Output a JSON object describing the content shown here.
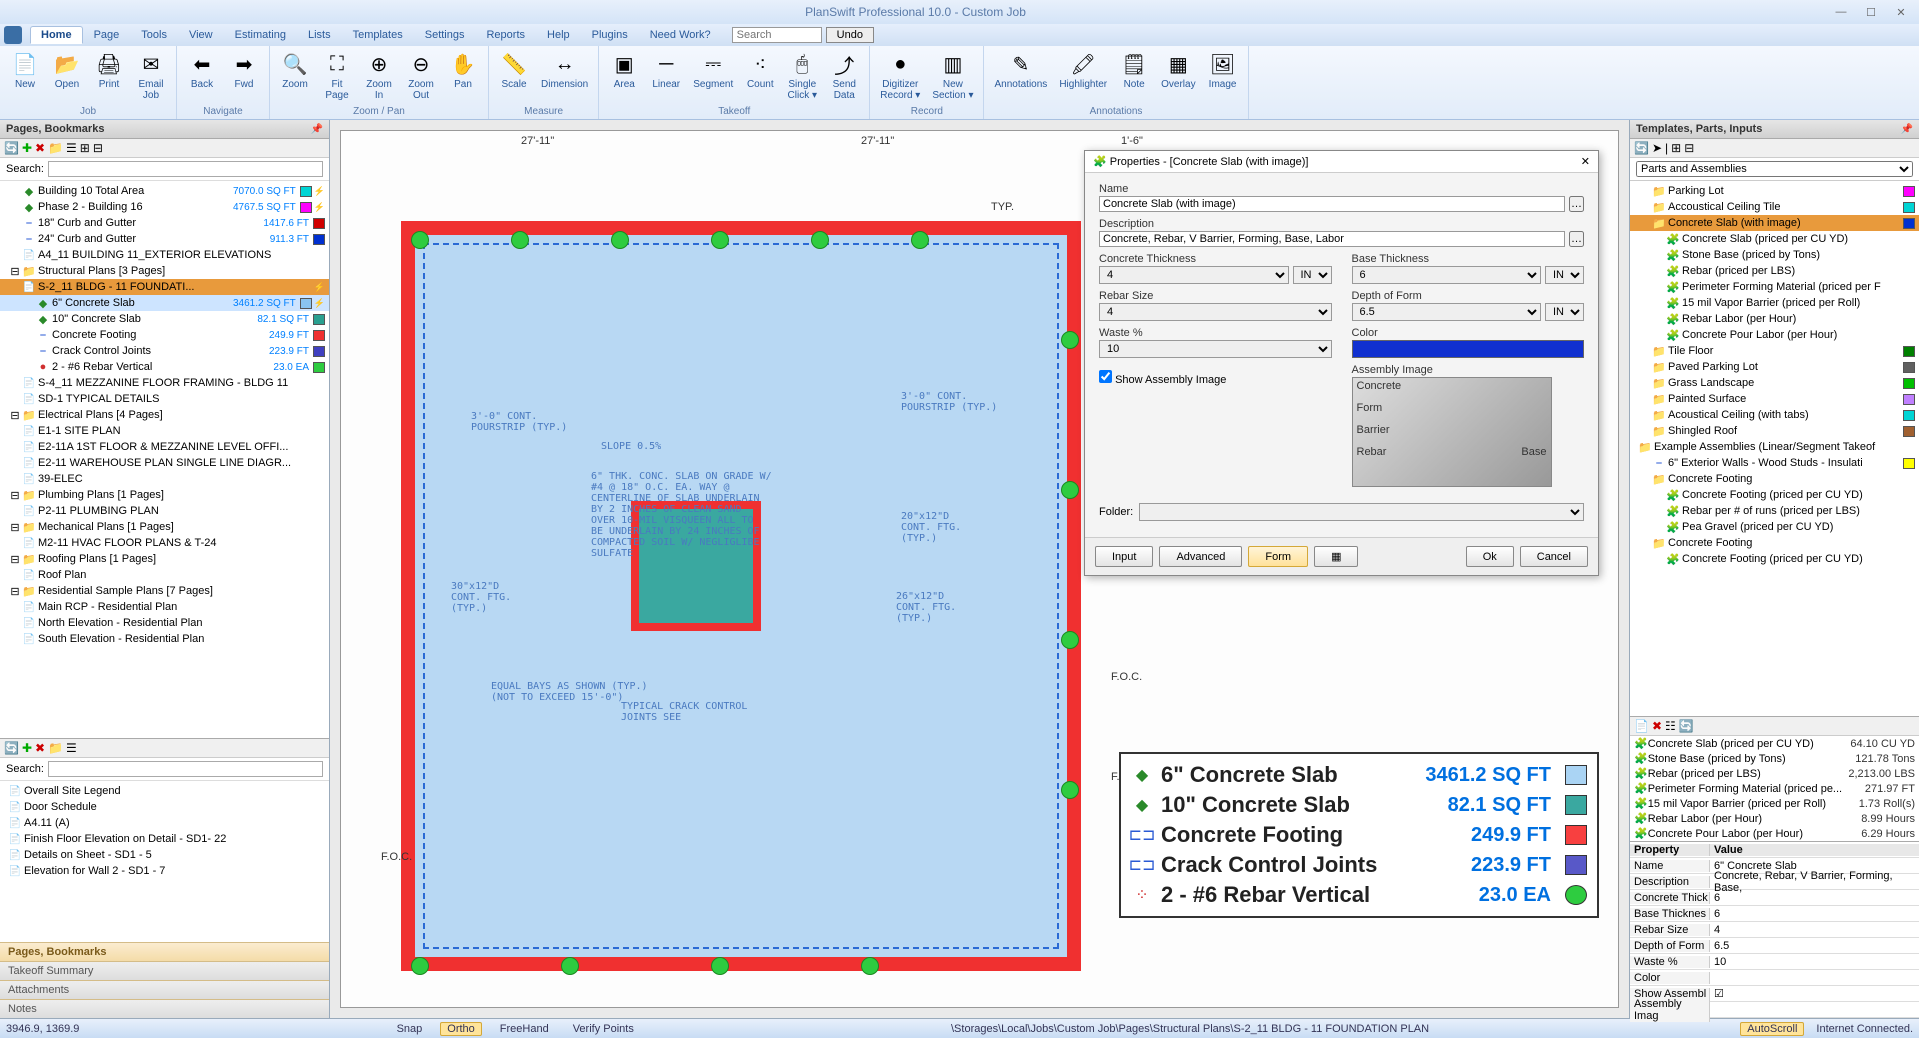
{
  "app": {
    "title": "PlanSwift Professional 10.0 - Custom Job",
    "undo_btn": "Undo",
    "search_placeholder": "Search"
  },
  "menutabs": [
    "Home",
    "Page",
    "Tools",
    "View",
    "Estimating",
    "Lists",
    "Templates",
    "Settings",
    "Reports",
    "Help",
    "Plugins",
    "Need Work?"
  ],
  "ribbon": {
    "groups": [
      {
        "label": "Job",
        "items": [
          {
            "l": "New",
            "i": "📄"
          },
          {
            "l": "Open",
            "i": "📂"
          },
          {
            "l": "Print",
            "i": "🖨"
          },
          {
            "l": "Email\nJob",
            "i": "✉"
          }
        ]
      },
      {
        "label": "Navigate",
        "items": [
          {
            "l": "Back",
            "i": "⬅"
          },
          {
            "l": "Fwd",
            "i": "➡"
          }
        ]
      },
      {
        "label": "Zoom / Pan",
        "items": [
          {
            "l": "Zoom",
            "i": "🔍"
          },
          {
            "l": "Fit\nPage",
            "i": "⛶"
          },
          {
            "l": "Zoom\nIn",
            "i": "⊕"
          },
          {
            "l": "Zoom\nOut",
            "i": "⊖"
          },
          {
            "l": "Pan",
            "i": "✋"
          }
        ]
      },
      {
        "label": "Measure",
        "items": [
          {
            "l": "Scale",
            "i": "📏"
          },
          {
            "l": "Dimension",
            "i": "↔"
          }
        ]
      },
      {
        "label": "Takeoff",
        "items": [
          {
            "l": "Area",
            "i": "▣"
          },
          {
            "l": "Linear",
            "i": "─"
          },
          {
            "l": "Segment",
            "i": "⎓"
          },
          {
            "l": "Count",
            "i": "⁖"
          },
          {
            "l": "Single\nClick ▾",
            "i": "🖱"
          },
          {
            "l": "Send\nData",
            "i": "⤴"
          }
        ]
      },
      {
        "label": "Record",
        "items": [
          {
            "l": "Digitizer\nRecord ▾",
            "i": "●"
          },
          {
            "l": "New\nSection ▾",
            "i": "▥"
          }
        ]
      },
      {
        "label": "Annotations",
        "items": [
          {
            "l": "Annotations",
            "i": "✎"
          },
          {
            "l": "Highlighter",
            "i": "🖍"
          },
          {
            "l": "Note",
            "i": "🗒"
          },
          {
            "l": "Overlay",
            "i": "▦"
          },
          {
            "l": "Image",
            "i": "🖼"
          }
        ]
      }
    ]
  },
  "left_header": "Pages, Bookmarks",
  "search_label": "Search:",
  "left_tree": [
    {
      "d": 1,
      "i": "area",
      "t": "Building 10 Total Area",
      "v": "7070.0 SQ FT",
      "c": "#00d4d4",
      "flag": true
    },
    {
      "d": 1,
      "i": "area",
      "t": "Phase 2 - Building 16",
      "v": "4767.5 SQ FT",
      "c": "#ff00ff",
      "flag": true
    },
    {
      "d": 1,
      "i": "lin",
      "t": "18\" Curb and Gutter",
      "v": "1417.6 FT",
      "c": "#d00000"
    },
    {
      "d": 1,
      "i": "lin",
      "t": "24\" Curb and Gutter",
      "v": "911.3 FT",
      "c": "#0030d0"
    },
    {
      "d": 1,
      "i": "file",
      "t": "A4_11 BUILDING 11_EXTERIOR ELEVATIONS"
    },
    {
      "d": 0,
      "i": "fold",
      "t": "Structural Plans [3 Pages]",
      "exp": true
    },
    {
      "d": 1,
      "i": "file",
      "t": "S-2_11 BLDG - 11 FOUNDATI...",
      "sel": true,
      "flag": true,
      "extra": "★ ⚡"
    },
    {
      "d": 2,
      "i": "area",
      "t": "6\" Concrete Slab",
      "v": "3461.2 SQ FT",
      "c": "#8ac4f0",
      "sel2": true,
      "flag": true
    },
    {
      "d": 2,
      "i": "area",
      "t": "10\" Concrete Slab",
      "v": "82.1 SQ FT",
      "c": "#2aa090"
    },
    {
      "d": 2,
      "i": "lin",
      "t": "Concrete Footing",
      "v": "249.9 FT",
      "c": "#f03030"
    },
    {
      "d": 2,
      "i": "lin",
      "t": "Crack Control Joints",
      "v": "223.9 FT",
      "c": "#4040c0"
    },
    {
      "d": 2,
      "i": "cnt",
      "t": "2 - #6 Rebar Vertical",
      "v": "23.0 EA",
      "c": "#2ecc40"
    },
    {
      "d": 1,
      "i": "file",
      "t": "S-4_11 MEZZANINE FLOOR FRAMING - BLDG 11"
    },
    {
      "d": 1,
      "i": "file",
      "t": "SD-1 TYPICAL DETAILS"
    },
    {
      "d": 0,
      "i": "fold",
      "t": "Electrical Plans [4 Pages]",
      "exp": true
    },
    {
      "d": 1,
      "i": "file",
      "t": "E1-1 SITE PLAN"
    },
    {
      "d": 1,
      "i": "file",
      "t": "E2-11A 1ST FLOOR & MEZZANINE LEVEL OFFI..."
    },
    {
      "d": 1,
      "i": "file",
      "t": "E2-11 WAREHOUSE PLAN SINGLE LINE DIAGR..."
    },
    {
      "d": 1,
      "i": "file",
      "t": "39-ELEC"
    },
    {
      "d": 0,
      "i": "fold",
      "t": "Plumbing Plans [1 Pages]",
      "exp": true
    },
    {
      "d": 1,
      "i": "file",
      "t": "P2-11 PLUMBING PLAN"
    },
    {
      "d": 0,
      "i": "fold",
      "t": "Mechanical Plans [1 Pages]",
      "exp": true
    },
    {
      "d": 1,
      "i": "file",
      "t": "M2-11 HVAC FLOOR PLANS & T-24"
    },
    {
      "d": 0,
      "i": "fold",
      "t": "Roofing Plans [1 Pages]",
      "exp": true
    },
    {
      "d": 1,
      "i": "file",
      "t": "Roof Plan"
    },
    {
      "d": 0,
      "i": "fold",
      "t": "Residential Sample Plans [7 Pages]",
      "exp": true
    },
    {
      "d": 1,
      "i": "file",
      "t": "Main RCP - Residential Plan"
    },
    {
      "d": 1,
      "i": "file",
      "t": "North Elevation - Residential Plan"
    },
    {
      "d": 1,
      "i": "file",
      "t": "South Elevation - Residential Plan"
    }
  ],
  "lower_left": [
    {
      "t": "Overall Site Legend"
    },
    {
      "t": "Door Schedule"
    },
    {
      "t": "A4.11 (A)"
    },
    {
      "t": "Finish Floor Elevation on Detail - SD1- 22"
    },
    {
      "t": "Details on Sheet - SD1 - 5"
    },
    {
      "t": "Elevation for Wall 2 - SD1 - 7"
    }
  ],
  "accordions": [
    "Pages, Bookmarks",
    "Takeoff Summary",
    "Attachments",
    "Notes"
  ],
  "drawing": {
    "top_dim_left": "27'-11\"",
    "top_dim_right": "27'-11\"",
    "top_dim_far": "1'-6\"",
    "pourstrip": "3'-0\" CONT.\nPOURSTRIP (TYP.)",
    "slab_note": "6\" THK. CONC. SLAB ON GRADE W/\n#4 @ 18\" O.C. EA. WAY @\nCENTERLINE OF SLAB UNDERLAIN\nBY 2 INCHES OF CLEAN SAND\nOVER 10-MIL VISQUEEN ALL TO\nBE UNDERLAIN BY 24 INCHES OF\nCOMPACTED SOIL W/ NEGLIGLIBE\nSULFATE",
    "slope": "SLOPE 0.5%",
    "ftg30": "30\"x12\"D\nCONT. FTG.\n(TYP.)",
    "ftg20": "20\"x12\"D\nCONT. FTG.\n(TYP.)",
    "ftg26": "26\"x12\"D\nCONT. FTG.\n(TYP.)",
    "bays": "EQUAL BAYS AS SHOWN (TYP.)\n(NOT TO EXCEED 15'-0\")",
    "crack": "TYPICAL CRACK CONTROL\nJOINTS SEE",
    "foc": "F.O.C.",
    "typ": "TYP."
  },
  "legend": [
    {
      "i": "◆",
      "ic": "#2a8a2a",
      "n": "6\" Concrete Slab",
      "v": "3461.2 SQ FT",
      "c": "#aad4f4"
    },
    {
      "i": "◆",
      "ic": "#2a8a2a",
      "n": "10\" Concrete Slab",
      "v": "82.1 SQ FT",
      "c": "#3aa8a0"
    },
    {
      "i": "⊏⊐",
      "ic": "#2a5ad4",
      "n": "Concrete Footing",
      "v": "249.9 FT",
      "c": "#f84040"
    },
    {
      "i": "⊏⊐",
      "ic": "#2a5ad4",
      "n": "Crack Control Joints",
      "v": "223.9 FT",
      "c": "#5858c8"
    },
    {
      "i": "⁘",
      "ic": "#d03030",
      "n": "2 - #6 Rebar Vertical",
      "v": "23.0 EA",
      "c": "#2ecc40",
      "round": true
    }
  ],
  "dialog": {
    "title": "Properties - [Concrete Slab (with image)]",
    "fields": {
      "name_l": "Name",
      "name_v": "Concrete Slab (with image)",
      "desc_l": "Description",
      "desc_v": "Concrete, Rebar, V Barrier, Forming, Base, Labor",
      "ct_l": "Concrete Thickness",
      "ct_v": "4",
      "ct_u": "IN",
      "bt_l": "Base Thickness",
      "bt_v": "6",
      "bt_u": "IN",
      "rs_l": "Rebar Size",
      "rs_v": "4",
      "df_l": "Depth of Form",
      "df_v": "6.5",
      "df_u": "IN",
      "w_l": "Waste %",
      "w_v": "10",
      "col_l": "Color",
      "show_l": "Show Assembly Image",
      "asm_l": "Assembly Image",
      "asm_labels": [
        "Concrete",
        "Form",
        "Barrier",
        "Rebar",
        "Base"
      ],
      "folder_l": "Folder:"
    },
    "btns": {
      "input": "Input",
      "advanced": "Advanced",
      "form": "Form",
      "ok": "Ok",
      "cancel": "Cancel"
    }
  },
  "right_header": "Templates, Parts, Inputs",
  "right_root": "Parts and Assemblies",
  "right_tree": [
    {
      "d": 1,
      "i": "fold",
      "t": "Parking Lot",
      "c": "#ff00ff"
    },
    {
      "d": 1,
      "i": "fold",
      "t": "Accoustical Ceiling Tile",
      "c": "#00d4d4"
    },
    {
      "d": 1,
      "i": "fold",
      "t": "Concrete Slab (with image)",
      "c": "#0030d0",
      "sel": true
    },
    {
      "d": 2,
      "i": "item",
      "t": "Concrete Slab (priced per CU YD)"
    },
    {
      "d": 2,
      "i": "item",
      "t": "Stone Base (priced by Tons)"
    },
    {
      "d": 2,
      "i": "item",
      "t": "Rebar (priced per LBS)"
    },
    {
      "d": 2,
      "i": "item",
      "t": "Perimeter Forming Material (priced per F"
    },
    {
      "d": 2,
      "i": "item",
      "t": "15 mil Vapor Barrier (priced per Roll)"
    },
    {
      "d": 2,
      "i": "item",
      "t": "Rebar Labor (per Hour)"
    },
    {
      "d": 2,
      "i": "item",
      "t": "Concrete Pour Labor (per Hour)"
    },
    {
      "d": 1,
      "i": "fold",
      "t": "Tile Floor",
      "c": "#008000"
    },
    {
      "d": 1,
      "i": "fold",
      "t": "Paved Parking Lot",
      "c": "#606060"
    },
    {
      "d": 1,
      "i": "fold",
      "t": "Grass Landscape",
      "c": "#00c000"
    },
    {
      "d": 1,
      "i": "fold",
      "t": "Painted Surface",
      "c": "#c080ff"
    },
    {
      "d": 1,
      "i": "fold",
      "t": "Acoustical Ceiling (with tabs)",
      "c": "#00d4d4"
    },
    {
      "d": 1,
      "i": "fold",
      "t": "Shingled Roof",
      "c": "#a06030"
    },
    {
      "d": 0,
      "i": "fold",
      "t": "Example Assemblies (Linear/Segment Takeof"
    },
    {
      "d": 1,
      "i": "lin",
      "t": "6\" Exterior Walls - Wood Studs - Insulati",
      "c": "#ffff00"
    },
    {
      "d": 1,
      "i": "fold",
      "t": "Concrete Footing"
    },
    {
      "d": 2,
      "i": "item",
      "t": "Concrete Footing (priced per CU YD)"
    },
    {
      "d": 2,
      "i": "item",
      "t": "Rebar per # of runs (priced per LBS)"
    },
    {
      "d": 2,
      "i": "item",
      "t": "Pea Gravel (priced per CU YD)"
    },
    {
      "d": 1,
      "i": "fold",
      "t": "Concrete Footing"
    },
    {
      "d": 2,
      "i": "item",
      "t": "Concrete Footing (priced per CU YD)"
    }
  ],
  "right_list": [
    {
      "n": "Concrete Slab (priced per CU YD)",
      "v": "64.10 CU YD"
    },
    {
      "n": "Stone Base (priced by Tons)",
      "v": "121.78 Tons"
    },
    {
      "n": "Rebar (priced per LBS)",
      "v": "2,213.00 LBS"
    },
    {
      "n": "Perimeter Forming Material (priced pe...",
      "v": "271.97 FT"
    },
    {
      "n": "15 mil Vapor Barrier (priced per Roll)",
      "v": "1.73 Roll(s)"
    },
    {
      "n": "Rebar Labor (per Hour)",
      "v": "8.99 Hours"
    },
    {
      "n": "Concrete Pour Labor (per Hour)",
      "v": "6.29 Hours"
    }
  ],
  "prop_table": {
    "hdr": [
      "Property",
      "Value"
    ],
    "rows": [
      [
        "Name",
        "6\" Concrete Slab"
      ],
      [
        "Description",
        "Concrete, Rebar, V Barrier, Forming, Base,"
      ],
      [
        "Concrete Thick",
        "6"
      ],
      [
        "Base Thicknes",
        "6"
      ],
      [
        "Rebar Size",
        "4"
      ],
      [
        "Depth of Form",
        "6.5"
      ],
      [
        "Waste %",
        "10"
      ],
      [
        "Color",
        ""
      ],
      [
        "Show Assembl",
        "☑"
      ],
      [
        "Assembly Imag",
        ""
      ]
    ]
  },
  "status": {
    "coords": "3946.9, 1369.9",
    "snap": "Snap",
    "ortho": "Ortho",
    "freehand": "FreeHand",
    "verify": "Verify Points",
    "path": "\\Storages\\Local\\Jobs\\Custom Job\\Pages\\Structural Plans\\S-2_11 BLDG - 11 FOUNDATION PLAN",
    "autoscroll": "AutoScroll",
    "net": "Internet Connected."
  }
}
